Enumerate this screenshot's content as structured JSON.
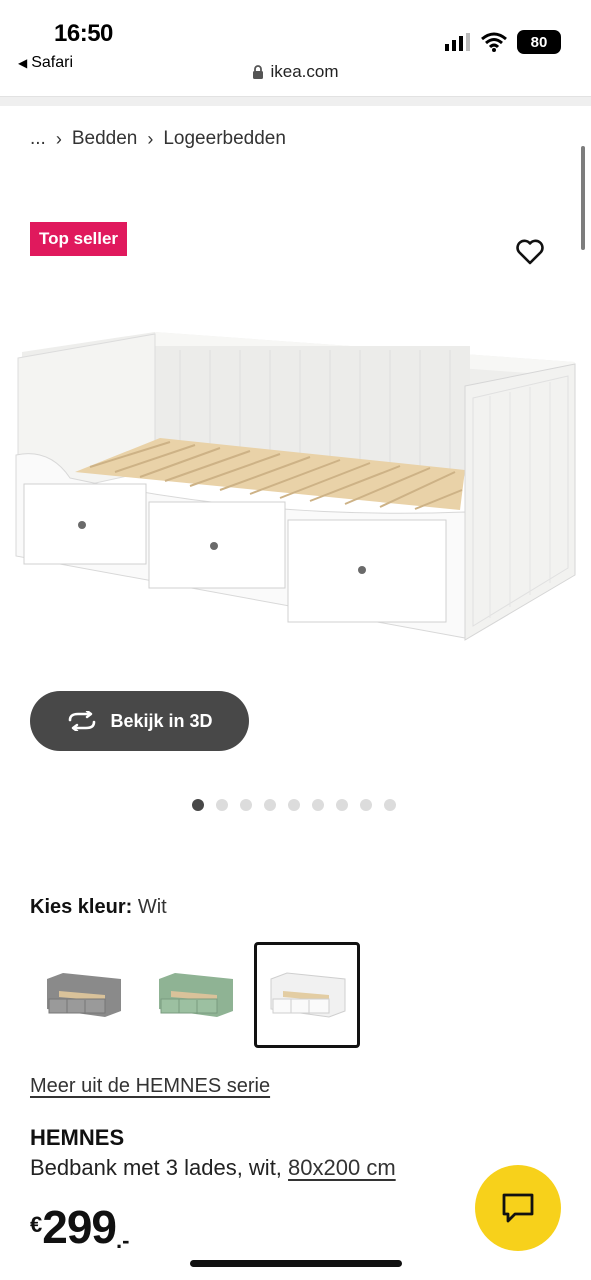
{
  "status_bar": {
    "time": "16:50",
    "back_app": "Safari",
    "battery": "80"
  },
  "browser": {
    "url": "ikea.com"
  },
  "breadcrumb": {
    "ellipsis": "...",
    "items": [
      "Bedden",
      "Logeerbedden"
    ]
  },
  "badge": {
    "top_seller": "Top seller",
    "color": "#e0195d"
  },
  "view3d": {
    "label": "Bekijk in 3D"
  },
  "carousel": {
    "count": 9,
    "active_index": 0
  },
  "color_choice": {
    "label": "Kies kleur:",
    "selected": "Wit",
    "swatches": [
      {
        "name": "grey-daybed-swatch",
        "color": "#8a8a8a"
      },
      {
        "name": "green-daybed-swatch",
        "color": "#8fb394"
      },
      {
        "name": "white-daybed-swatch",
        "color": "#f4f4f4"
      }
    ]
  },
  "series_link": "Meer uit de HEMNES serie",
  "product": {
    "name": "HEMNES",
    "description": "Bedbank met 3 lades, wit,",
    "size": "80x200 cm"
  },
  "price": {
    "currency": "€",
    "amount": "299",
    "decimals": ".-"
  },
  "colors": {
    "dark_button": "#484848",
    "chat_yellow": "#f7d11b"
  }
}
